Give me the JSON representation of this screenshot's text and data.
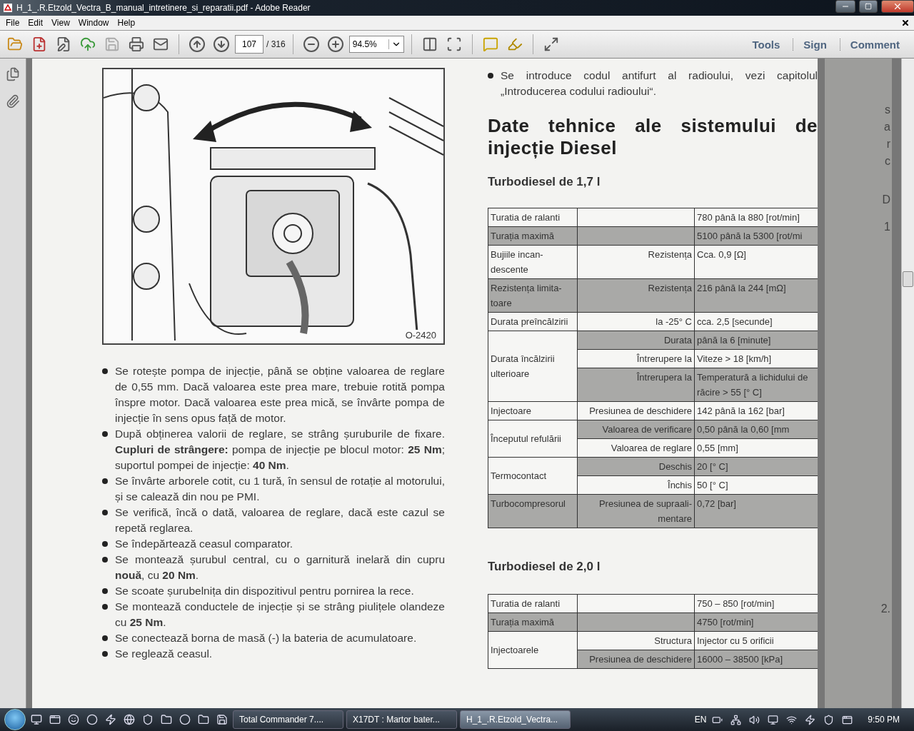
{
  "window": {
    "title": "H_1_.R.Etzold_Vectra_B_manual_intretinere_si_reparatii.pdf - Adobe Reader"
  },
  "menu": [
    "File",
    "Edit",
    "View",
    "Window",
    "Help"
  ],
  "toolbar": {
    "page": "107",
    "page_total": "/ 316",
    "zoom": "94.5%",
    "panels": [
      "Tools",
      "Sign",
      "Comment"
    ]
  },
  "document": {
    "figure": {
      "caption": "O-2420"
    },
    "left_bullets": [
      "Se rotește pompa de injecție, până se obține valoarea de reglare de 0,55 mm. Dacă valoarea este prea mare, trebuie rotită pompa înspre motor. Dacă valoarea este prea mică, se învârte pompa de injecție în sens opus față de motor.",
      "După obținerea valorii de reglare, se strâng șuruburile de fixare. **Cupluri de strângere:** pompa de injecție pe blocul motor: **25 Nm**; suportul pompei de injecție: **40 Nm**.",
      "Se învârte arborele cotit, cu 1 tură, în sensul de rotație al motorului, și se calează din nou pe PMI.",
      "Se verifică, încă o dată, valoarea de reglare, dacă este cazul se repetă reglarea.",
      "Se îndepărtează ceasul comparator.",
      "Se montează șurubul central, cu o garnitură inelară din cupru **nouă**, cu **20 Nm**.",
      "Se scoate șurubelnița din dispozitivul pentru pornirea la rece.",
      "Se montează conductele de injecție și se strâng piulițele olandeze cu **25 Nm**.",
      "Se conectează borna de masă (-) la bateria de acumulatoare.",
      "Se reglează ceasul."
    ],
    "right_bullets": [
      "Se introduce codul antifurt al radioului, vezi capitolul „Introducerea codului radioului“."
    ],
    "heading": "Date tehnice ale sistemului de injecție Diesel",
    "tables": [
      {
        "title": "Turbodiesel de 1,7 l",
        "groups": [
          {
            "label": "Turatia de ralanti",
            "shaded": false,
            "rows": [
              {
                "value": "780 până la 880 [rot/min]",
                "shaded": false
              }
            ]
          },
          {
            "label": "Turația maximă",
            "shaded": true,
            "rows": [
              {
                "value": "5100 până la 5300 [rot/mi",
                "shaded": true
              }
            ]
          },
          {
            "label": "Bujiile incan-descente",
            "shaded": false,
            "rows": [
              {
                "param": "Rezistența",
                "value": "Cca. 0,9 [Ω]",
                "shaded": false
              }
            ]
          },
          {
            "label": "Rezistența limita-toare",
            "shaded": true,
            "rows": [
              {
                "param": "Rezistența",
                "value": "216 până la 244 [mΩ]",
                "shaded": true
              }
            ]
          },
          {
            "label": "Durata preîncălzirii",
            "shaded": false,
            "rows": [
              {
                "param": "la -25° C",
                "value": "cca. 2,5 [secunde]",
                "shaded": false
              }
            ]
          },
          {
            "label": "Durata încălzirii ulterioare",
            "shaded": false,
            "rows": [
              {
                "param": "Durata",
                "value": "până la 6 [minute]",
                "shaded": true
              },
              {
                "param": "Întrerupere la",
                "value": "Viteze > 18 [km/h]",
                "shaded": false
              },
              {
                "param": "Întrerupera la",
                "value": "Temperatură a lichidului de răcire > 55 [° C]",
                "shaded": true
              }
            ]
          },
          {
            "label": "Injectoare",
            "shaded": false,
            "rows": [
              {
                "param": "Presiunea de deschidere",
                "value": "142 până la 162 [bar]",
                "shaded": false
              }
            ]
          },
          {
            "label": "Începutul refulării",
            "shaded": false,
            "rows": [
              {
                "param": "Valoarea de verificare",
                "value": "0,50 până la 0,60 [mm",
                "shaded": true
              },
              {
                "param": "Valoarea de reglare",
                "value": "0,55 [mm]",
                "shaded": false
              }
            ]
          },
          {
            "label": "Termocontact",
            "shaded": false,
            "rows": [
              {
                "param": "Deschis",
                "value": "20 [° C]",
                "shaded": true
              },
              {
                "param": "Închis",
                "value": "50 [° C]",
                "shaded": false
              }
            ]
          },
          {
            "label": "Turbocompresorul",
            "shaded": true,
            "rows": [
              {
                "param": "Presiunea de supraali-mentare",
                "value": "0,72 [bar]",
                "shaded": true
              }
            ]
          }
        ]
      },
      {
        "title": "Turbodiesel de 2,0 l",
        "groups": [
          {
            "label": "Turatia de ralanti",
            "shaded": false,
            "rows": [
              {
                "value": "750 – 850 [rot/min]",
                "shaded": false
              }
            ]
          },
          {
            "label": "Turația maximă",
            "shaded": true,
            "rows": [
              {
                "value": "4750 [rot/min]",
                "shaded": true
              }
            ]
          },
          {
            "label": "Injectoarele",
            "shaded": false,
            "rows": [
              {
                "param": "Structura",
                "value": "Injector cu 5 orificii",
                "shaded": false
              },
              {
                "param": "Presiunea de deschidere",
                "value": "16000 – 38500 [kPa]",
                "shaded": true
              }
            ]
          }
        ]
      }
    ],
    "next_page_fragments": [
      "s",
      "a",
      "r",
      "c",
      "D",
      "1",
      "2."
    ]
  },
  "taskbar": {
    "tasks": [
      {
        "label": "Total Commander 7....",
        "selected": false
      },
      {
        "label": "X17DT : Martor bater...",
        "selected": false
      },
      {
        "label": "H_1_.R.Etzold_Vectra...",
        "selected": true
      }
    ],
    "language": "EN",
    "clock": "9:50 PM"
  }
}
